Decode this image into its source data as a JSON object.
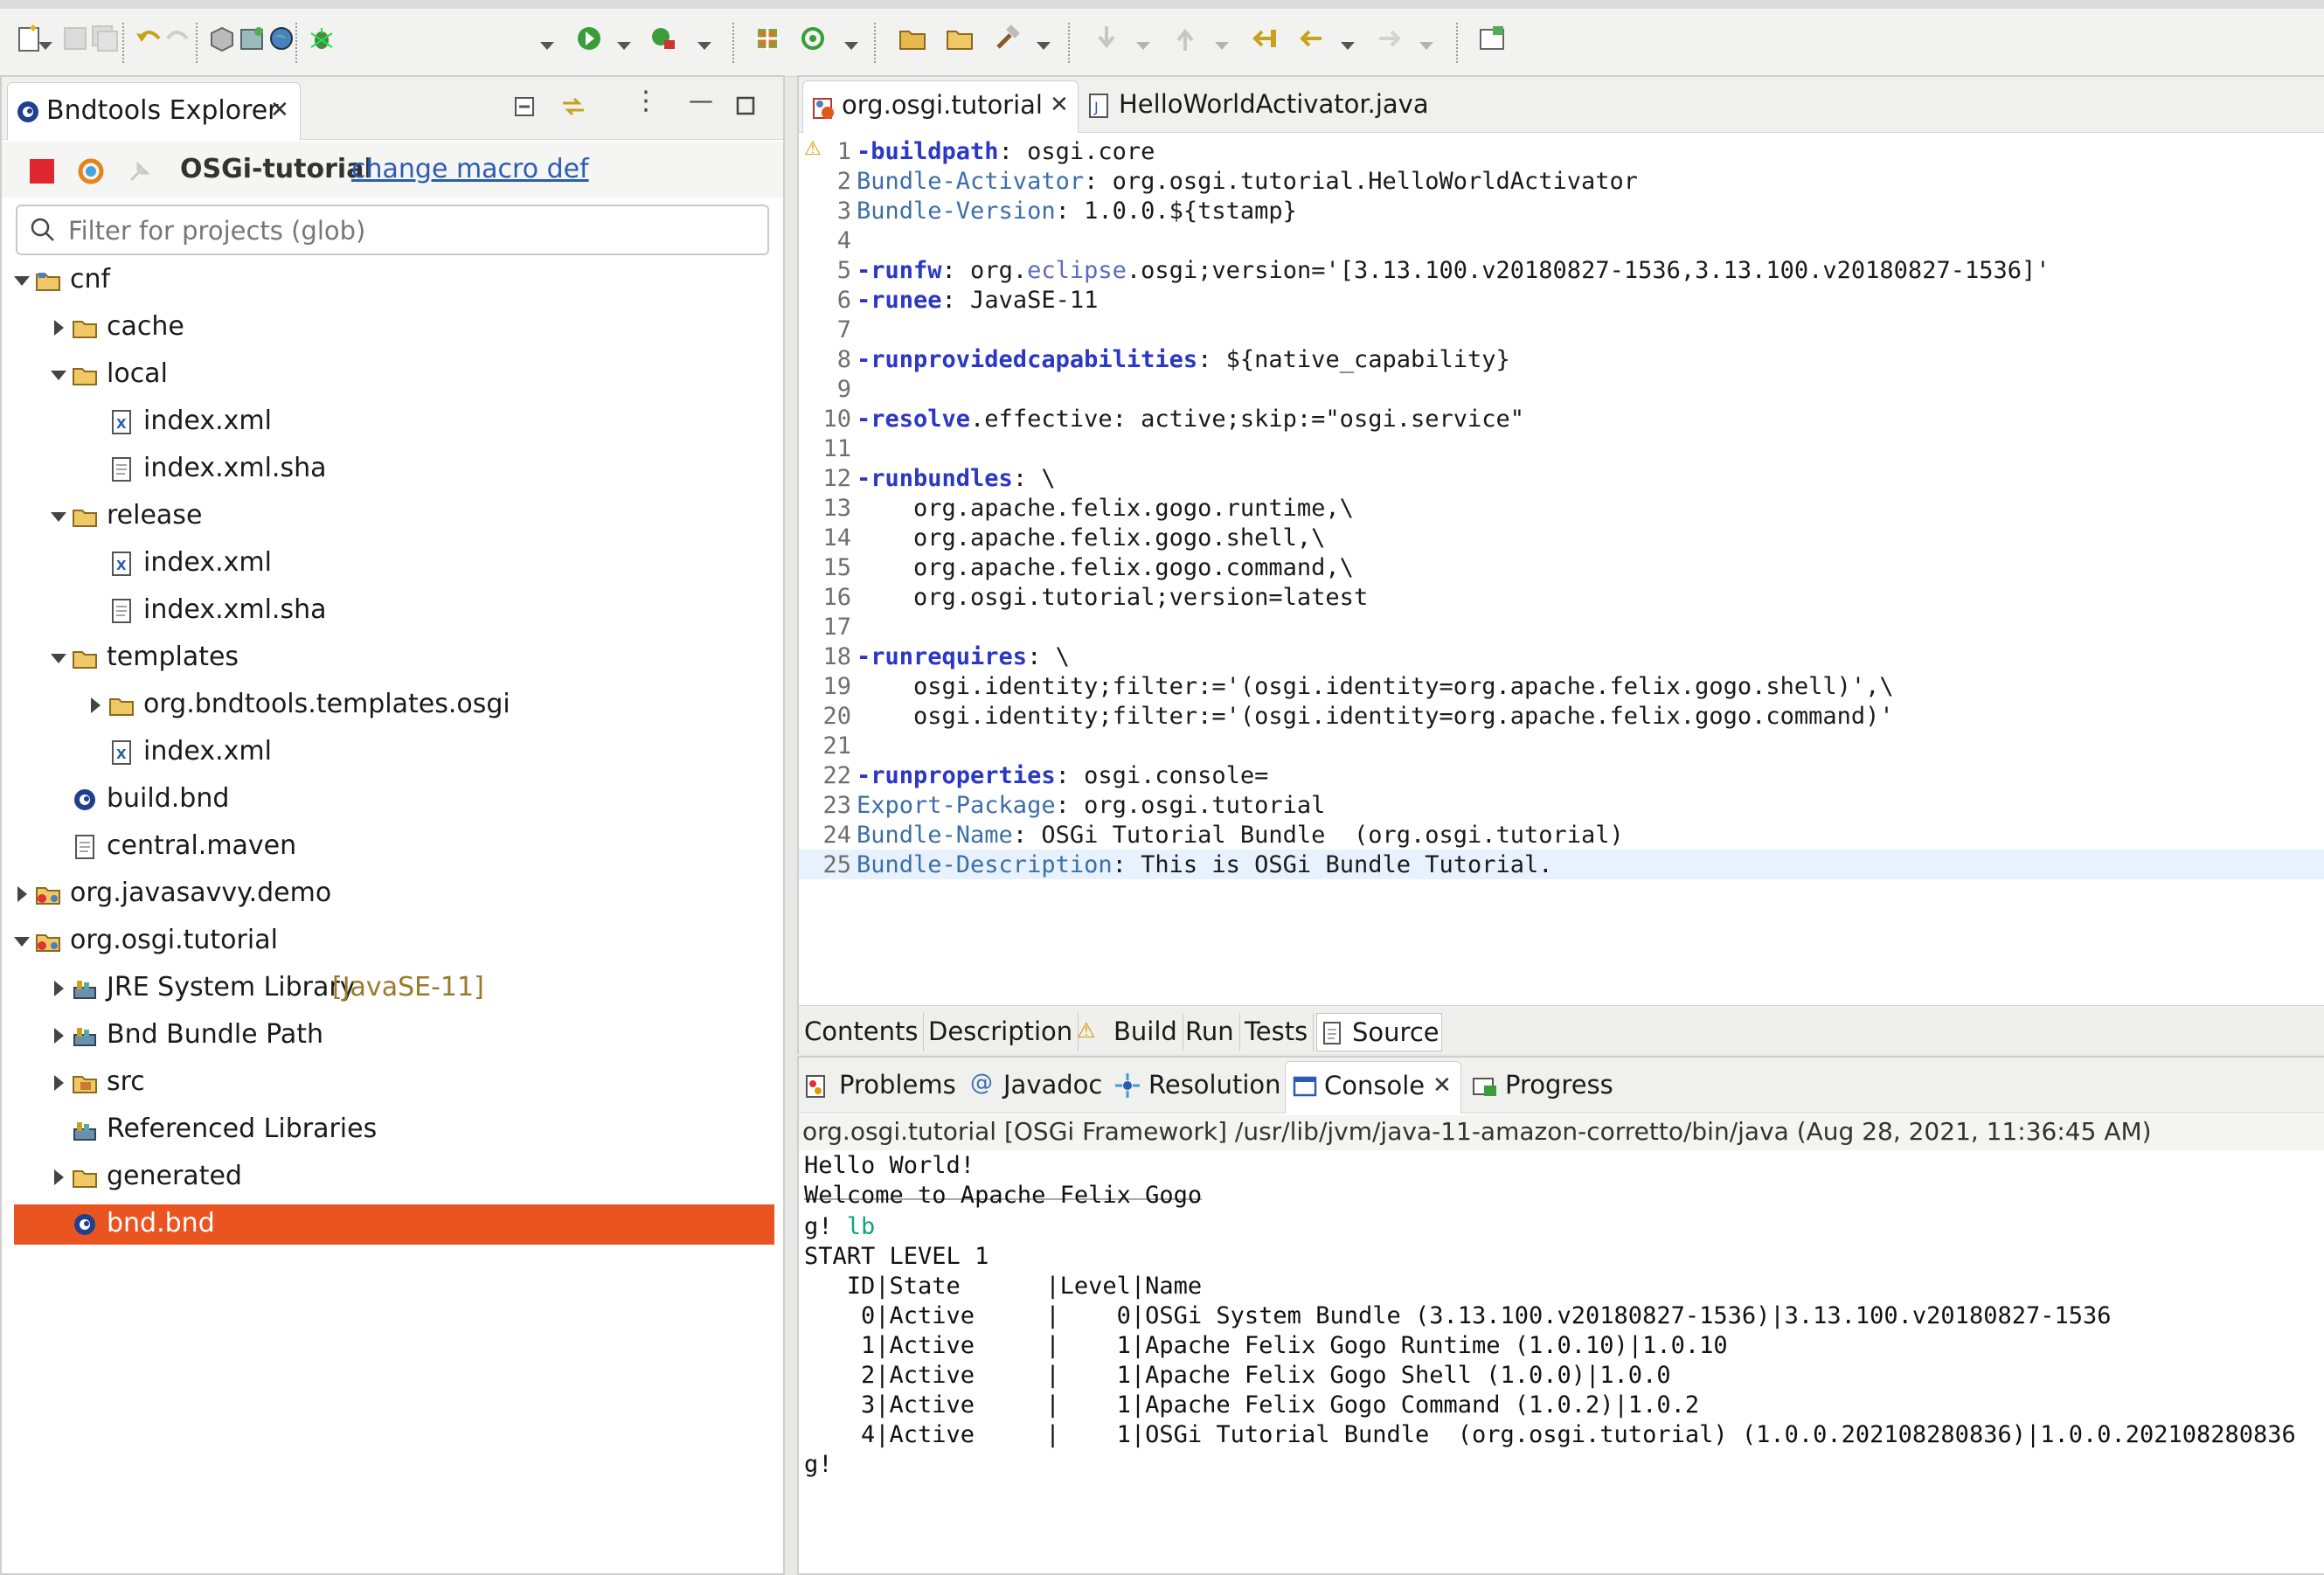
{
  "toolbar": {
    "icons": [
      "new-icon",
      "save-icon",
      "save-all-icon",
      "undo-icon",
      "redo-icon",
      "package-icon",
      "bundle-icon",
      "globe-icon",
      "debug-icon",
      "run-icon",
      "external-tools-icon",
      "new-class-icon",
      "refresh-icon",
      "open-folder-icon",
      "open-type-icon",
      "hammer-icon",
      "next-annotation-icon",
      "prev-annotation-icon",
      "last-edit-icon",
      "back-icon",
      "forward-icon",
      "open-perspective-icon"
    ]
  },
  "explorer": {
    "title": "Bndtools Explorer",
    "project_name": "OSGi-tutorial",
    "change_macro_link": "change macro def",
    "filter_placeholder": "Filter for projects (glob)",
    "tree": [
      {
        "label": "cnf",
        "icon": "project-folder-icon"
      },
      {
        "label": "cache",
        "icon": "folder-icon"
      },
      {
        "label": "local",
        "icon": "folder-icon"
      },
      {
        "label": "index.xml",
        "icon": "xml-file-icon"
      },
      {
        "label": "index.xml.sha",
        "icon": "text-file-icon"
      },
      {
        "label": "release",
        "icon": "folder-icon"
      },
      {
        "label": "index.xml",
        "icon": "xml-file-icon"
      },
      {
        "label": "index.xml.sha",
        "icon": "text-file-icon"
      },
      {
        "label": "templates",
        "icon": "folder-icon"
      },
      {
        "label": "org.bndtools.templates.osgi",
        "icon": "folder-icon"
      },
      {
        "label": "index.xml",
        "icon": "xml-file-icon"
      },
      {
        "label": "build.bnd",
        "icon": "bnd-file-icon"
      },
      {
        "label": "central.maven",
        "icon": "text-file-icon"
      },
      {
        "label": "org.javasavvy.demo",
        "icon": "bundle-project-icon"
      },
      {
        "label": "org.osgi.tutorial",
        "icon": "bundle-project-icon"
      },
      {
        "label": "JRE System Library",
        "suffix": "[JavaSE-11]",
        "icon": "library-icon"
      },
      {
        "label": "Bnd Bundle Path",
        "icon": "library-icon"
      },
      {
        "label": "src",
        "icon": "package-folder-icon"
      },
      {
        "label": "Referenced Libraries",
        "icon": "library-icon"
      },
      {
        "label": "generated",
        "icon": "folder-icon"
      },
      {
        "label": "bnd.bnd",
        "icon": "bnd-file-icon"
      }
    ]
  },
  "editor": {
    "tabs": [
      "org.osgi.tutorial",
      "HelloWorldActivator.java"
    ],
    "lines": [
      {
        "n": "1",
        "segs": [
          [
            "k",
            "-buildpath"
          ],
          [
            "p",
            ": osgi.core"
          ]
        ]
      },
      {
        "n": "2",
        "segs": [
          [
            "h",
            "Bundle-Activator"
          ],
          [
            "p",
            ": org.osgi.tutorial.HelloWorldActivator"
          ]
        ]
      },
      {
        "n": "3",
        "segs": [
          [
            "h",
            "Bundle-Version"
          ],
          [
            "p",
            ": 1.0.0.${tstamp}"
          ]
        ]
      },
      {
        "n": "4",
        "segs": []
      },
      {
        "n": "5",
        "segs": [
          [
            "k",
            "-runfw"
          ],
          [
            "p",
            ": org."
          ],
          [
            "e",
            "eclipse"
          ],
          [
            "p",
            ".osgi;version='[3.13.100.v20180827-1536,3.13.100.v20180827-1536]'"
          ]
        ]
      },
      {
        "n": "6",
        "segs": [
          [
            "k",
            "-runee"
          ],
          [
            "p",
            ": JavaSE-11"
          ]
        ]
      },
      {
        "n": "7",
        "segs": []
      },
      {
        "n": "8",
        "segs": [
          [
            "k",
            "-runprovidedcapabilities"
          ],
          [
            "p",
            ": ${native_capability}"
          ]
        ]
      },
      {
        "n": "9",
        "segs": []
      },
      {
        "n": "10",
        "segs": [
          [
            "k",
            "-resolve"
          ],
          [
            "p",
            ".effective: active;skip:=\"osgi.service\""
          ]
        ]
      },
      {
        "n": "11",
        "segs": []
      },
      {
        "n": "12",
        "segs": [
          [
            "k",
            "-runbundles"
          ],
          [
            "p",
            ": \\"
          ]
        ]
      },
      {
        "n": "13",
        "segs": [
          [
            "p",
            "    org.apache.felix.gogo.runtime,\\"
          ]
        ]
      },
      {
        "n": "14",
        "segs": [
          [
            "p",
            "    org.apache.felix.gogo.shell,\\"
          ]
        ]
      },
      {
        "n": "15",
        "segs": [
          [
            "p",
            "    org.apache.felix.gogo.command,\\"
          ]
        ]
      },
      {
        "n": "16",
        "segs": [
          [
            "p",
            "    org.osgi.tutorial;version=latest"
          ]
        ]
      },
      {
        "n": "17",
        "segs": []
      },
      {
        "n": "18",
        "segs": [
          [
            "k",
            "-runrequires"
          ],
          [
            "p",
            ": \\"
          ]
        ]
      },
      {
        "n": "19",
        "segs": [
          [
            "p",
            "    osgi.identity;filter:='(osgi.identity=org.apache.felix.gogo.shell)',\\"
          ]
        ]
      },
      {
        "n": "20",
        "segs": [
          [
            "p",
            "    osgi.identity;filter:='(osgi.identity=org.apache.felix.gogo.command)'"
          ]
        ]
      },
      {
        "n": "21",
        "segs": []
      },
      {
        "n": "22",
        "segs": [
          [
            "k",
            "-runproperties"
          ],
          [
            "p",
            ": osgi.console="
          ]
        ]
      },
      {
        "n": "23",
        "segs": [
          [
            "h",
            "Export-Package"
          ],
          [
            "p",
            ": org.osgi.tutorial"
          ]
        ]
      },
      {
        "n": "24",
        "segs": [
          [
            "h",
            "Bundle-Name"
          ],
          [
            "p",
            ": OSGi Tutorial Bundle  (org.osgi.tutorial)"
          ]
        ]
      },
      {
        "n": "25",
        "segs": [
          [
            "h",
            "Bundle-Description"
          ],
          [
            "p",
            ": This is OSGi Bundle Tutorial."
          ]
        ]
      }
    ],
    "bottom_tabs": [
      "Contents",
      "Description",
      "Build",
      "Run",
      "Tests",
      "Source"
    ]
  },
  "console": {
    "tabs": [
      "Problems",
      "Javadoc",
      "Resolution",
      "Console",
      "Progress"
    ],
    "title": "org.osgi.tutorial [OSGi Framework] /usr/lib/jvm/java-11-amazon-corretto/bin/java (Aug 28, 2021, 11:36:45 AM)",
    "hello": "Hello World!",
    "rule": "____________________________",
    "welcome": "Welcome to Apache Felix Gogo",
    "prompt": "g! ",
    "command": "lb",
    "start_level": "START LEVEL 1",
    "header": "   ID|State      |Level|Name",
    "rows": [
      "    0|Active     |    0|OSGi System Bundle (3.13.100.v20180827-1536)|3.13.100.v20180827-1536",
      "    1|Active     |    1|Apache Felix Gogo Runtime (1.0.10)|1.0.10",
      "    2|Active     |    1|Apache Felix Gogo Shell (1.0.0)|1.0.0",
      "    3|Active     |    1|Apache Felix Gogo Command (1.0.2)|1.0.2",
      "    4|Active     |    1|OSGi Tutorial Bundle  (org.osgi.tutorial) (1.0.0.202108280836)|1.0.0.202108280836"
    ],
    "end_prompt": "g!"
  },
  "colors": {
    "selection": "#e95420",
    "keyword": "#2b38c4",
    "header": "#3b6fa8",
    "link": "#2a5db0",
    "gogo_command": "#10a37f"
  }
}
